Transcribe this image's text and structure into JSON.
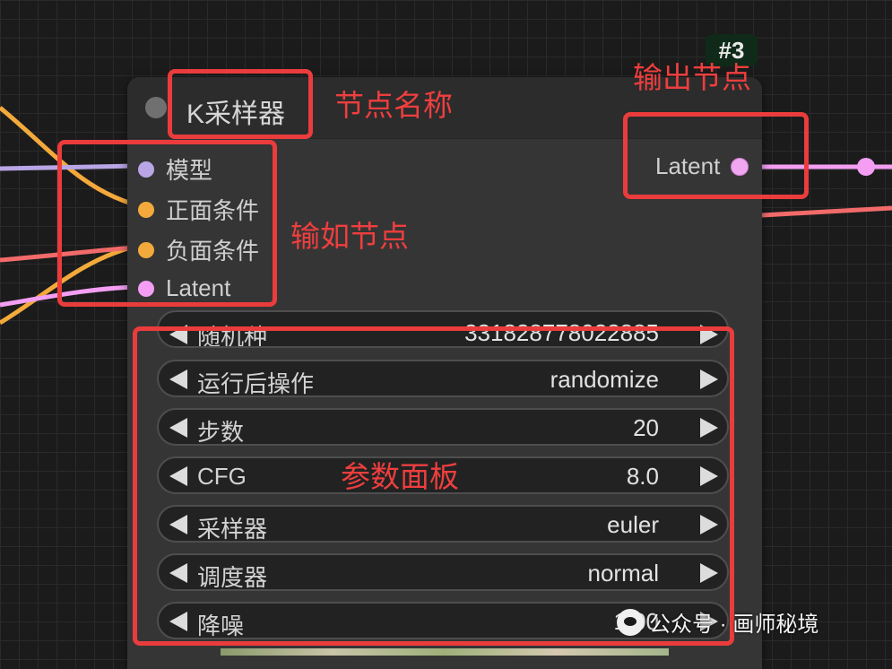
{
  "node": {
    "title": "K采样器",
    "id_badge": "#3",
    "inputs": [
      {
        "label": "模型",
        "color": "#b9a6e6"
      },
      {
        "label": "正面条件",
        "color": "#f3a93b"
      },
      {
        "label": "负面条件",
        "color": "#f3a93b"
      },
      {
        "label": "Latent",
        "color": "#f39ef3"
      }
    ],
    "output": {
      "label": "Latent",
      "color": "#f0a6f0"
    },
    "widgets": [
      {
        "name": "随机种",
        "value": "331828778022885"
      },
      {
        "name": "运行后操作",
        "value": "randomize"
      },
      {
        "name": "步数",
        "value": "20"
      },
      {
        "name": "CFG",
        "value": "8.0"
      },
      {
        "name": "采样器",
        "value": "euler"
      },
      {
        "name": "调度器",
        "value": "normal"
      },
      {
        "name": "降噪",
        "value": "1.00"
      }
    ]
  },
  "annotations": {
    "node_name": "节点名称",
    "output_nodes": "输出节点",
    "input_nodes": "输如节点",
    "param_panel": "参数面板",
    "accent_color": "#ea3c3c"
  },
  "wire_colors": {
    "model": "#b9a6e6",
    "conditioning": "#f3a93b",
    "latent": "#f39ef3",
    "vae": "#f26a6a"
  },
  "watermark": {
    "text": "公众号 · 画师秘境",
    "icon": "wechat-icon"
  }
}
